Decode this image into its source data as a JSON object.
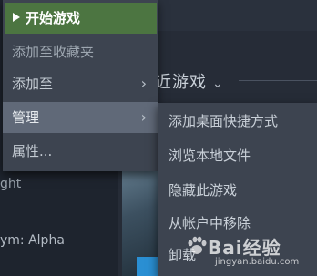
{
  "background": {
    "section_heading": "近游戏",
    "heading_chevron_icon": "chevron-down-icon",
    "text_fragment_1": "ght",
    "text_fragment_2": "ym: Alpha"
  },
  "context_menu": {
    "play_label": "开始游戏",
    "play_icon": "play-icon",
    "add_favorites_label": "添加至收藏夹",
    "add_to_label": "添加至",
    "manage_label": "管理",
    "properties_label": "属性...",
    "chevron_icon": "chevron-right-icon",
    "colors": {
      "play_bg": "#4c7541",
      "menu_bg": "#3d4450",
      "hover_bg": "#606978"
    }
  },
  "manage_submenu": {
    "items": [
      "添加桌面快捷方式",
      "浏览本地文件",
      "隐藏此游戏",
      "从帐户中移除",
      "卸载"
    ]
  },
  "watermark": {
    "brand": "Bai经验",
    "url": "jingyan.baidu.com"
  }
}
